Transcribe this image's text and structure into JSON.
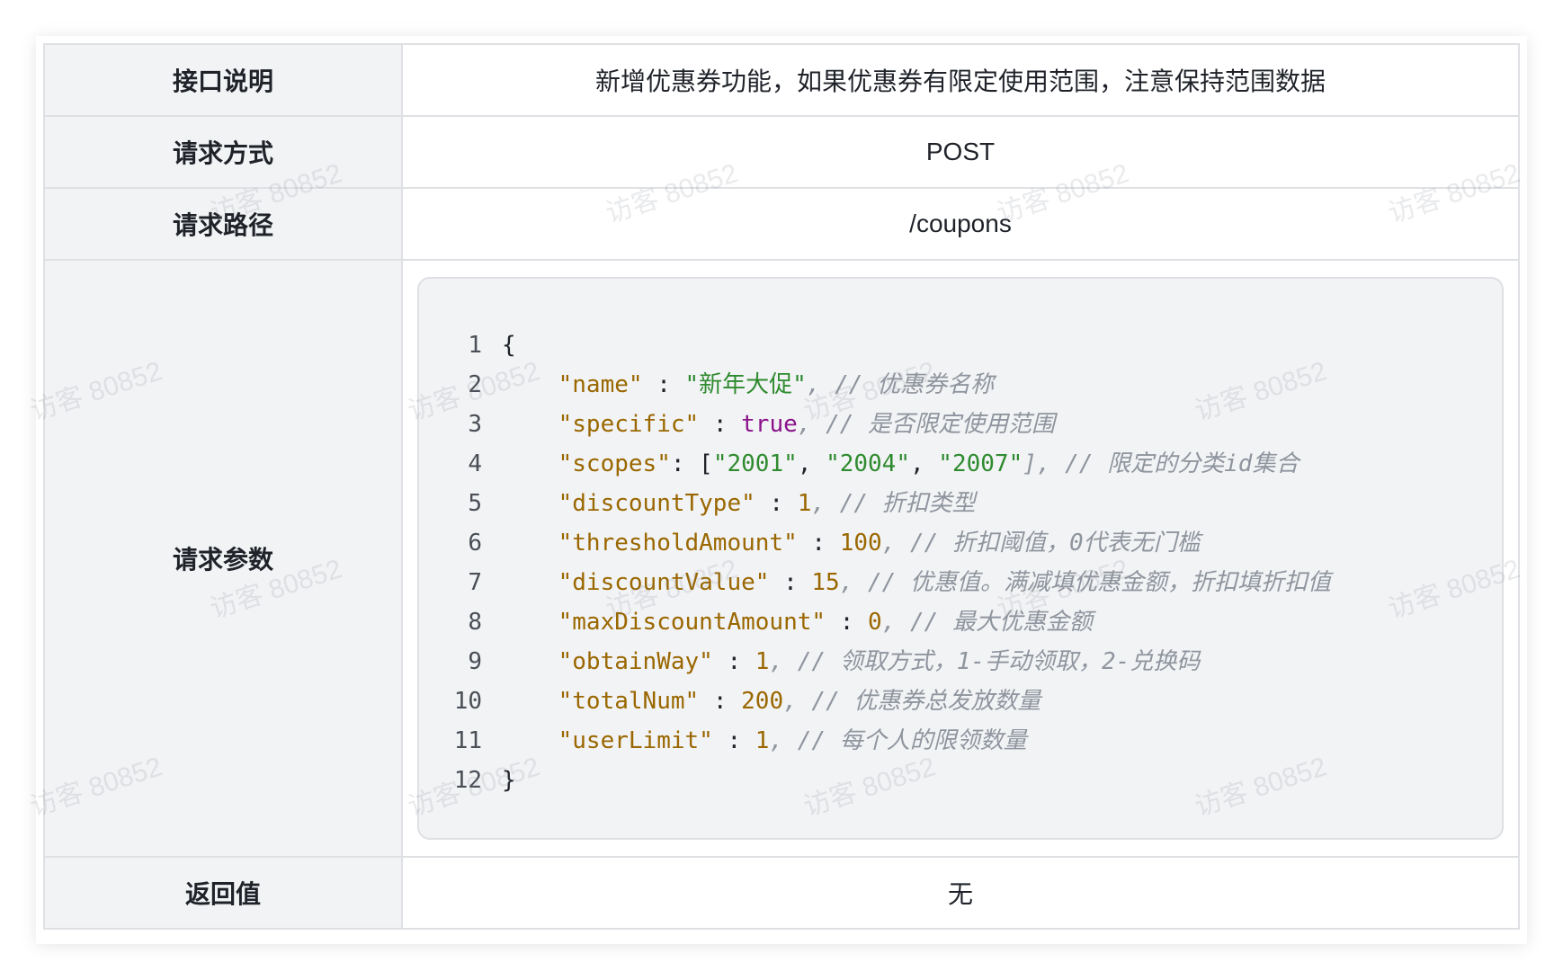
{
  "rows": {
    "desc": {
      "label": "接口说明",
      "value": "新增优惠券功能，如果优惠券有限定使用范围，注意保持范围数据"
    },
    "method": {
      "label": "请求方式",
      "value": "POST"
    },
    "path": {
      "label": "请求路径",
      "value": "/coupons"
    },
    "params": {
      "label": "请求参数"
    },
    "ret": {
      "label": "返回值",
      "value": "无"
    }
  },
  "code": {
    "line_numbers": [
      "1",
      "2",
      "3",
      "4",
      "5",
      "6",
      "7",
      "8",
      "9",
      "10",
      "11",
      "12"
    ],
    "open_brace": "{",
    "close_brace": "}",
    "fields": [
      {
        "key": "\"name\"",
        "sep": " : ",
        "val": "\"新年大促\"",
        "val_type": "string",
        "comment": ", // 优惠券名称"
      },
      {
        "key": "\"specific\"",
        "sep": " : ",
        "val": "true",
        "val_type": "bool",
        "comment": ", // 是否限定使用范围"
      },
      {
        "key": "\"scopes\"",
        "sep": ": [",
        "vals": [
          "\"2001\"",
          "\"2004\"",
          "\"2007\""
        ],
        "val_type": "array",
        "comment": "], // 限定的分类id集合"
      },
      {
        "key": "\"discountType\"",
        "sep": " : ",
        "val": "1",
        "val_type": "number",
        "comment": ", // 折扣类型"
      },
      {
        "key": "\"thresholdAmount\"",
        "sep": " : ",
        "val": "100",
        "val_type": "number",
        "comment": ", // 折扣阈值，0代表无门槛"
      },
      {
        "key": "\"discountValue\"",
        "sep": " : ",
        "val": "15",
        "val_type": "number",
        "comment": ", // 优惠值。满减填优惠金额，折扣填折扣值"
      },
      {
        "key": "\"maxDiscountAmount\"",
        "sep": " : ",
        "val": "0",
        "val_type": "number",
        "comment": ", // 最大优惠金额"
      },
      {
        "key": "\"obtainWay\"",
        "sep": " : ",
        "val": "1",
        "val_type": "number",
        "comment": ", // 领取方式，1-手动领取，2-兑换码"
      },
      {
        "key": "\"totalNum\"",
        "sep": " : ",
        "val": "200",
        "val_type": "number",
        "comment": ", // 优惠券总发放数量"
      },
      {
        "key": "\"userLimit\"",
        "sep": " : ",
        "val": "1",
        "val_type": "number",
        "comment": ", // 每个人的限领数量"
      }
    ]
  },
  "watermark": "访客 80852",
  "colors": {
    "label_bg": "#f2f3f5",
    "border": "#dee0e3",
    "key": "#9a6700",
    "string": "#2f8b2f",
    "bool": "#8b128b",
    "comment": "#8f959e"
  }
}
